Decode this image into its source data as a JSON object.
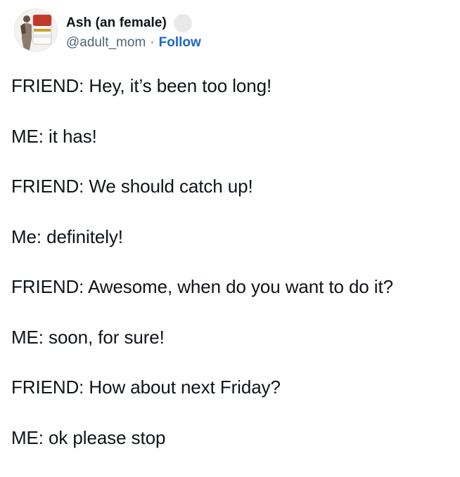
{
  "author": {
    "display_name": "Ash (an female)",
    "handle": "@adult_mom",
    "separator": "·",
    "follow_label": "Follow",
    "avatar_icon": "soup-can-avatar-icon",
    "verified_icon": "badge-placeholder-icon"
  },
  "tweet": {
    "lines": [
      "FRIEND: Hey, it’s been too long!",
      "ME: it has!",
      "FRIEND: We should catch up!",
      "Me: definitely!",
      "FRIEND: Awesome, when do you want to do it?",
      "ME: soon, for sure!",
      "FRIEND: How about next Friday?",
      "ME: ok please stop"
    ]
  },
  "colors": {
    "text": "#0f1419",
    "secondary": "#536471",
    "link": "#1d68c3"
  }
}
